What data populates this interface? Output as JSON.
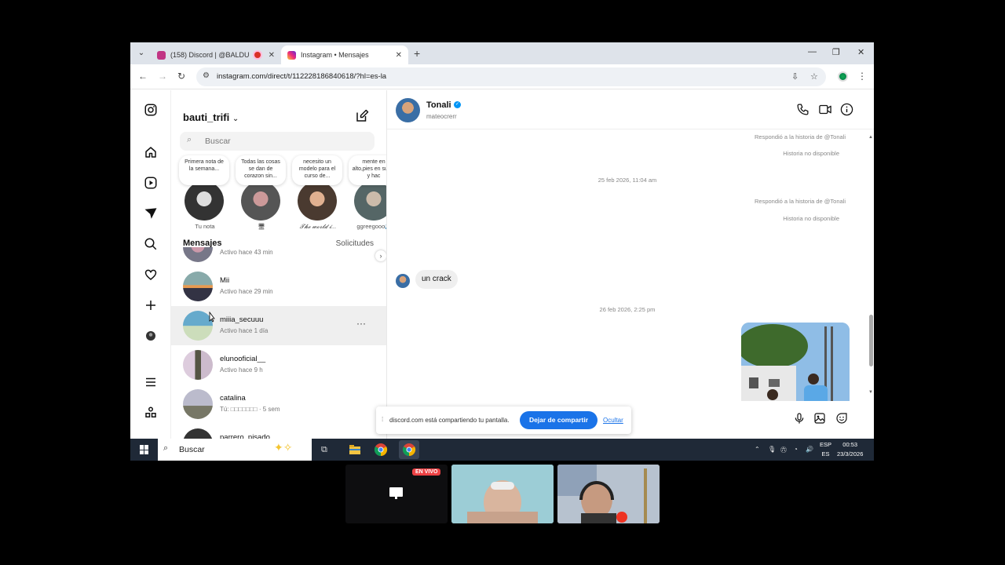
{
  "browser": {
    "tabs": [
      {
        "title": "(158) Discord | @BALDU",
        "active": false
      },
      {
        "title": "Instagram • Mensajes",
        "active": true
      }
    ],
    "url": "instagram.com/direct/t/112228186840618/?hl=es-la"
  },
  "sidebar": {
    "username": "bauti_trifi",
    "search_placeholder": "Buscar",
    "notes": [
      {
        "text": "Primera nota de la semana...",
        "label": "Tu nota"
      },
      {
        "text": "Todas las cosas se dan de corazon sin...",
        "label": ""
      },
      {
        "text": "necesito un modelo para el curso de...",
        "label": "𝓣𝓱𝓮 𝔀𝓸𝓻𝓵𝓭 𝓲..."
      },
      {
        "text": "mente en alto,pies en suelo y hac",
        "label": "ggreegooo🌊"
      }
    ],
    "messages_heading": "Mensajes",
    "requests_label": "Solicitudes",
    "conversations": [
      {
        "name": "",
        "status": "Activo hace 43 min"
      },
      {
        "name": "Mii",
        "status": "Activo hace 29 min"
      },
      {
        "name": "miiia_secuuu",
        "status": "Activo hace 1 día"
      },
      {
        "name": "elunooficial__",
        "status": "Activo hace 9 h"
      },
      {
        "name": "catalina",
        "status": "Tú: □□□□□□□ · 5 sem"
      },
      {
        "name": "parrero_pisado",
        "status": ""
      }
    ]
  },
  "chat": {
    "contact_name": "Tonali",
    "contact_handle": "mateocrerr",
    "system_1": "Respondió a la historia de @Tonali",
    "unavailable_1": "Historia no disponible",
    "timestamp_1": "25 feb 2026, 11:04 am",
    "system_2": "Respondió a la historia de @Tonali",
    "unavailable_2": "Historia no disponible",
    "incoming_text": "un crack",
    "timestamp_2": "26 feb 2026, 2:25 pm"
  },
  "sharebar": {
    "text": "discord.com está compartiendo tu pantalla.",
    "stop_label": "Dejar de compartir",
    "hide_label": "Ocultar"
  },
  "taskbar": {
    "search_label": "Buscar",
    "lang_1": "ESP",
    "lang_2": "ES",
    "time": "00:53",
    "date": "23/3/2026"
  },
  "call": {
    "live_badge": "EN VIVO"
  }
}
